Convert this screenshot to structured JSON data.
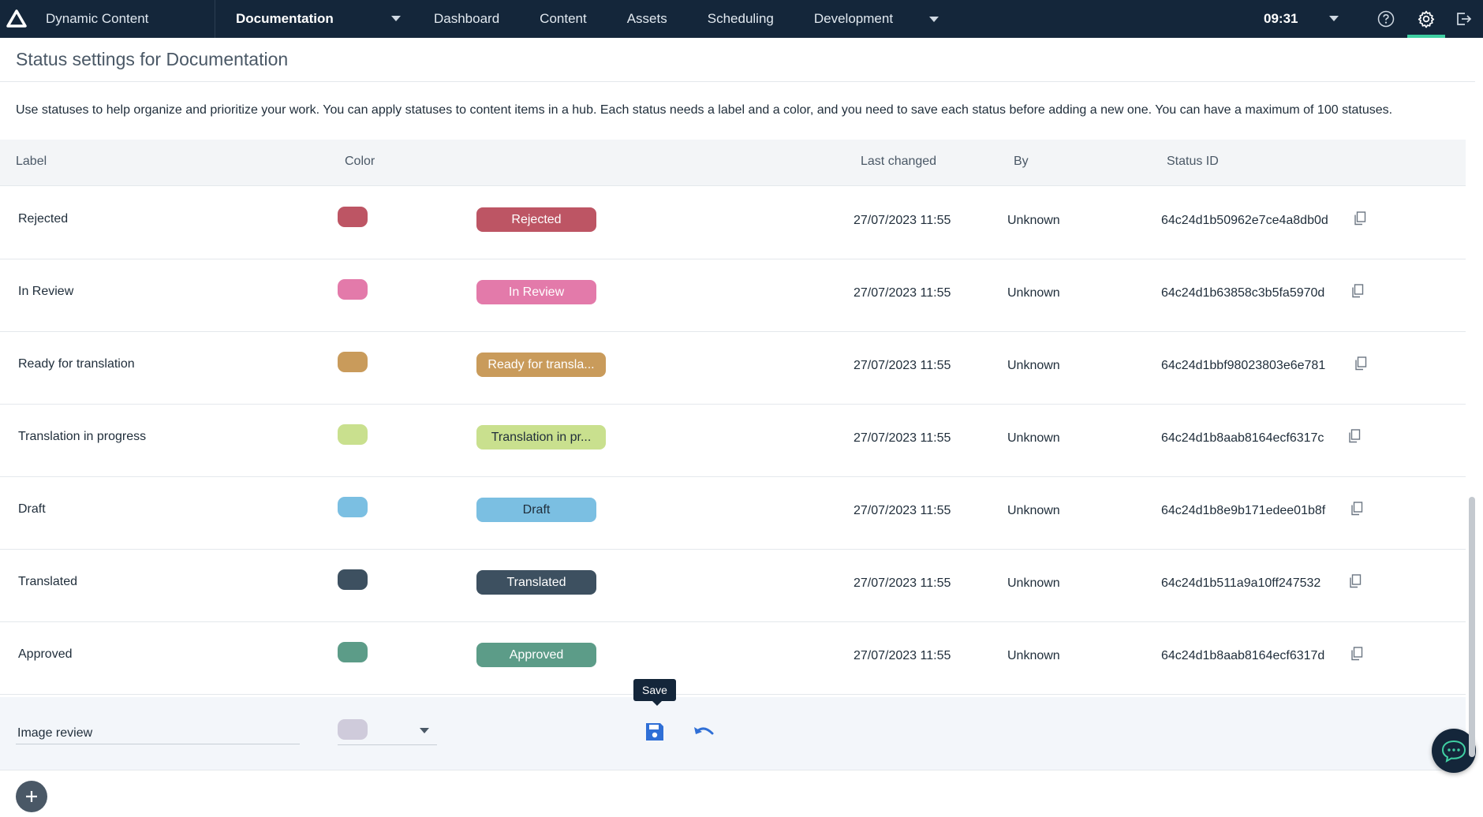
{
  "topbar": {
    "app_name": "Dynamic Content",
    "hub": "Documentation",
    "nav": [
      "Dashboard",
      "Content",
      "Assets",
      "Scheduling"
    ],
    "nav_dev": "Development",
    "time": "09:31"
  },
  "page": {
    "title": "Status settings for Documentation",
    "intro": "Use statuses to help organize and prioritize your work. You can apply statuses to content items in a hub. Each status needs a label and a color, and you need to save each status before adding a new one. You can have a maximum of 100 statuses."
  },
  "columns": {
    "label": "Label",
    "color": "Color",
    "last_changed": "Last changed",
    "by": "By",
    "status_id": "Status ID"
  },
  "statuses": [
    {
      "label": "Rejected",
      "pill": "Rejected",
      "color": "#bd5564",
      "date": "27/07/2023 11:55",
      "by": "Unknown",
      "id": "64c24d1b50962e7ce4a8db0d"
    },
    {
      "label": "In Review",
      "pill": "In Review",
      "color": "#e37aaa",
      "date": "27/07/2023 11:55",
      "by": "Unknown",
      "id": "64c24d1b63858c3b5fa5970d"
    },
    {
      "label": "Ready for translation",
      "pill": "Ready for transla...",
      "color": "#c99b5b",
      "date": "27/07/2023 11:55",
      "by": "Unknown",
      "id": "64c24d1bbf98023803e6e781"
    },
    {
      "label": "Translation in progress",
      "pill": "Translation in pr...",
      "color": "#c9e08e",
      "date": "27/07/2023 11:55",
      "by": "Unknown",
      "id": "64c24d1b8aab8164ecf6317c"
    },
    {
      "label": "Draft",
      "pill": "Draft",
      "color": "#7bbfe2",
      "date": "27/07/2023 11:55",
      "by": "Unknown",
      "id": "64c24d1b8e9b171edee01b8f"
    },
    {
      "label": "Translated",
      "pill": "Translated",
      "color": "#3d5060",
      "date": "27/07/2023 11:55",
      "by": "Unknown",
      "id": "64c24d1b511a9a10ff247532"
    },
    {
      "label": "Approved",
      "pill": "Approved",
      "color": "#5c9c88",
      "date": "27/07/2023 11:55",
      "by": "Unknown",
      "id": "64c24d1b8aab8164ecf6317d"
    }
  ],
  "new_status": {
    "value": "Image review",
    "swatch_color": "#cfcbdb",
    "tooltip": "Save"
  },
  "colors": {
    "topbar": "#14263a",
    "accent": "#3fcfa2",
    "save_blue": "#2f6fd6"
  }
}
